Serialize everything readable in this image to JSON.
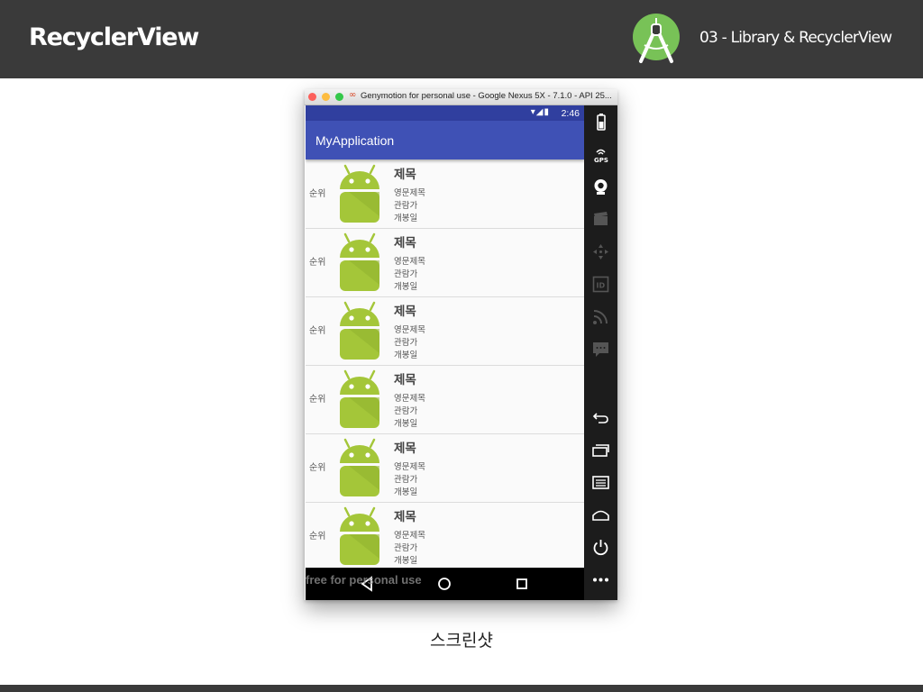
{
  "slide": {
    "title": "RecyclerView",
    "subtitle": "03 - Library & RecyclerView",
    "caption": "스크린샷"
  },
  "window": {
    "title": "Genymotion for personal use - Google Nexus 5X - 7.1.0 - API 25...",
    "watermark": "free for personal use"
  },
  "device": {
    "status_time": "2:46",
    "app_title": "MyApplication",
    "list_items": [
      {
        "rank": "순위",
        "title": "제목",
        "english_title": "영문제목",
        "audience": "관람가",
        "release": "개봉일"
      },
      {
        "rank": "순위",
        "title": "제목",
        "english_title": "영문제목",
        "audience": "관람가",
        "release": "개봉일"
      },
      {
        "rank": "순위",
        "title": "제목",
        "english_title": "영문제목",
        "audience": "관람가",
        "release": "개봉일"
      },
      {
        "rank": "순위",
        "title": "제목",
        "english_title": "영문제목",
        "audience": "관람가",
        "release": "개봉일"
      },
      {
        "rank": "순위",
        "title": "제목",
        "english_title": "영문제목",
        "audience": "관람가",
        "release": "개봉일"
      },
      {
        "rank": "순위",
        "title": "제목",
        "english_title": "영문제목",
        "audience": "관람가",
        "release": "개봉일"
      }
    ]
  },
  "toolbar_icons": [
    "battery-icon",
    "gps-icon",
    "webcam-icon",
    "capture-icon",
    "dpad-icon",
    "identifiers-icon",
    "network-icon",
    "sms-icon",
    "back-icon",
    "recent-apps-icon",
    "menu-icon",
    "home-icon",
    "power-icon",
    "more-icon"
  ],
  "colors": {
    "header_bg": "#3a3a3a",
    "app_bar": "#3f51b5",
    "status_bar": "#303f9f",
    "android_green": "#a4c639"
  }
}
